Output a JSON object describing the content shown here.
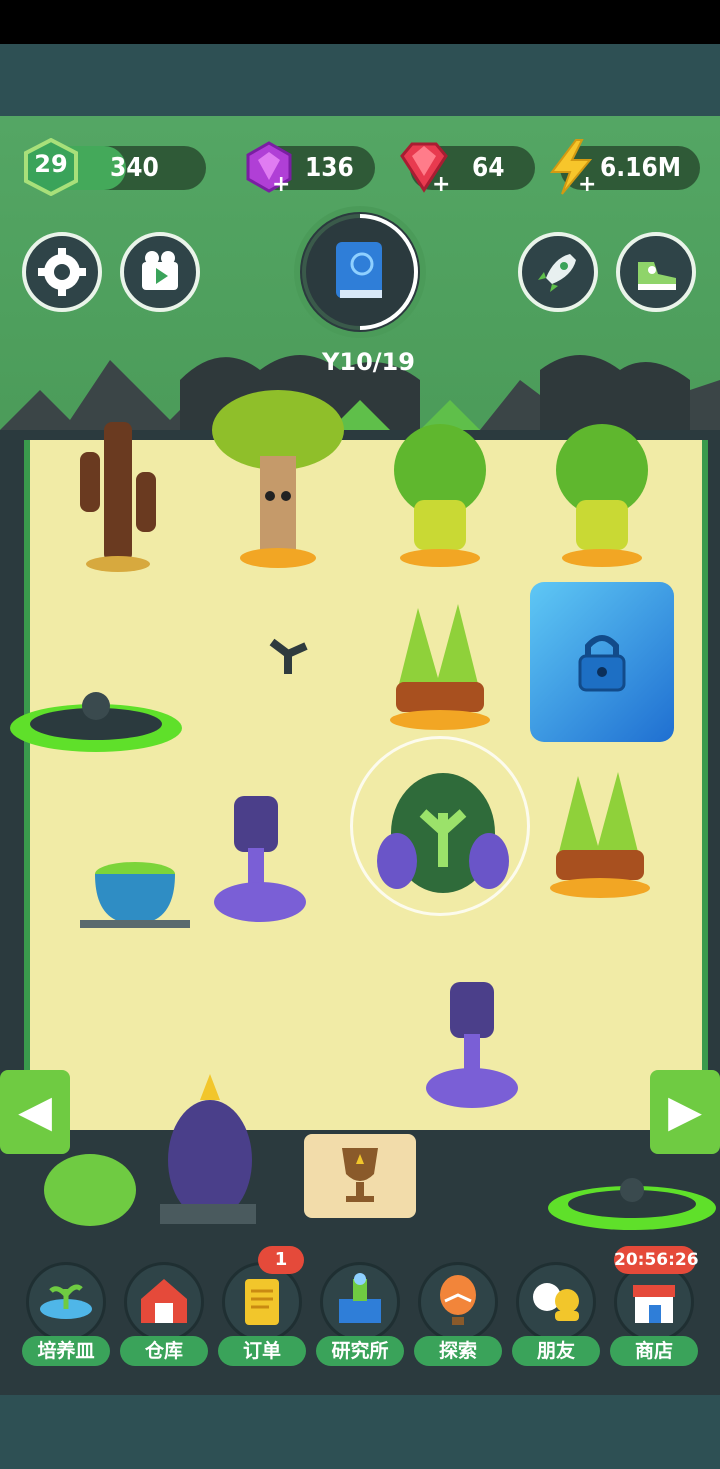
{
  "hud": {
    "level": "29",
    "xp": "340",
    "gems": "136",
    "rubies": "64",
    "energy": "6.16M"
  },
  "quest": {
    "progress": "10/19"
  },
  "timer": "20:56:26",
  "orders_badge": "1",
  "dock": [
    {
      "label": "培养皿",
      "icon": "petri-dish-icon"
    },
    {
      "label": "仓库",
      "icon": "barn-icon"
    },
    {
      "label": "订单",
      "icon": "scroll-icon"
    },
    {
      "label": "研究所",
      "icon": "lab-icon"
    },
    {
      "label": "探索",
      "icon": "balloon-icon"
    },
    {
      "label": "朋友",
      "icon": "friends-icon"
    },
    {
      "label": "商店",
      "icon": "shop-icon"
    }
  ],
  "colors": {
    "sky": "#54a664",
    "board": "#f1eba6",
    "accent": "#6fcb42",
    "badge": "#e54a3a"
  }
}
